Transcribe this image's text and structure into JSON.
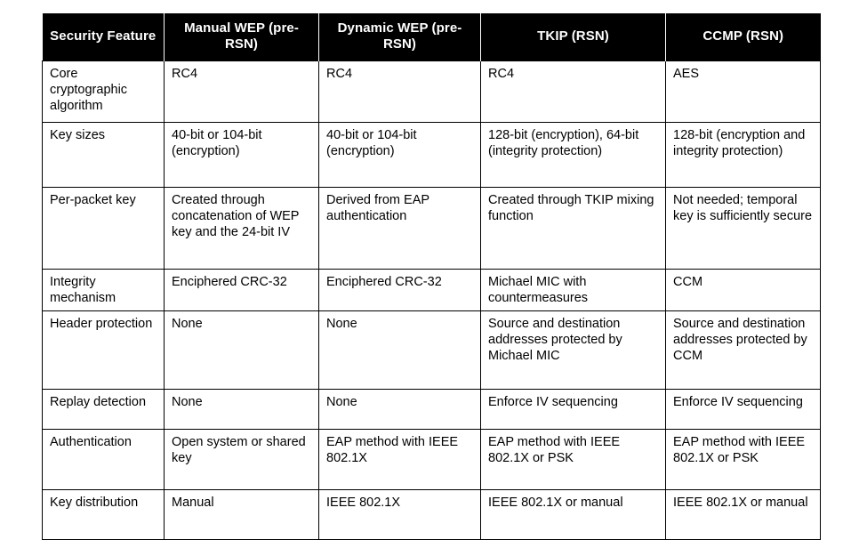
{
  "table": {
    "name": "wireless-security-comparison",
    "headers": [
      "Security Feature",
      "Manual  WEP (pre-RSN)",
      "Dynamic WEP (pre-RSN)",
      "TKIP (RSN)",
      "CCMP (RSN)"
    ],
    "rows": [
      {
        "feature": "Core cryptographic algorithm",
        "manual_wep": "RC4",
        "dynamic_wep": "RC4",
        "tkip": "RC4",
        "ccmp": "AES"
      },
      {
        "feature": "Key sizes",
        "manual_wep": "40-bit or 104-bit (encryption)",
        "dynamic_wep": "40-bit or 104-bit (encryption)",
        "tkip": "128-bit (encryption), 64-bit (integrity protection)",
        "ccmp": "128-bit (encryption and integrity protection)"
      },
      {
        "feature": "Per-packet key",
        "manual_wep": "Created through concatenation of WEP key and the 24-bit IV",
        "dynamic_wep": "Derived from EAP authentication",
        "tkip": "Created through TKIP mixing function",
        "ccmp": "Not needed; temporal key is sufficiently secure"
      },
      {
        "feature": "Integrity mechanism",
        "manual_wep": "Enciphered CRC-32",
        "dynamic_wep": "Enciphered CRC-32",
        "tkip": "Michael MIC with countermeasures",
        "ccmp": "CCM"
      },
      {
        "feature": "Header protection",
        "manual_wep": "None",
        "dynamic_wep": "None",
        "tkip": "Source and destination addresses protected by Michael MIC",
        "ccmp": "Source and destination addresses protected by CCM"
      },
      {
        "feature": "Replay detection",
        "manual_wep": "None",
        "dynamic_wep": "None",
        "tkip": "Enforce IV sequencing",
        "ccmp": "Enforce IV sequencing"
      },
      {
        "feature": "Authentication",
        "manual_wep": "Open system or shared key",
        "dynamic_wep": "EAP method with IEEE 802.1X",
        "tkip": "EAP method with IEEE 802.1X or PSK",
        "ccmp": "EAP method with IEEE 802.1X or PSK"
      },
      {
        "feature": "Key distribution",
        "manual_wep": "Manual",
        "dynamic_wep": "IEEE 802.1X",
        "tkip": "IEEE 802.1X or manual",
        "ccmp": "IEEE 802.1X or manual"
      }
    ]
  },
  "colors": {
    "header_background": "#000000",
    "header_text": "#ffffff",
    "body_background": "#ffffff",
    "body_text": "#000000",
    "border": "#000000"
  }
}
